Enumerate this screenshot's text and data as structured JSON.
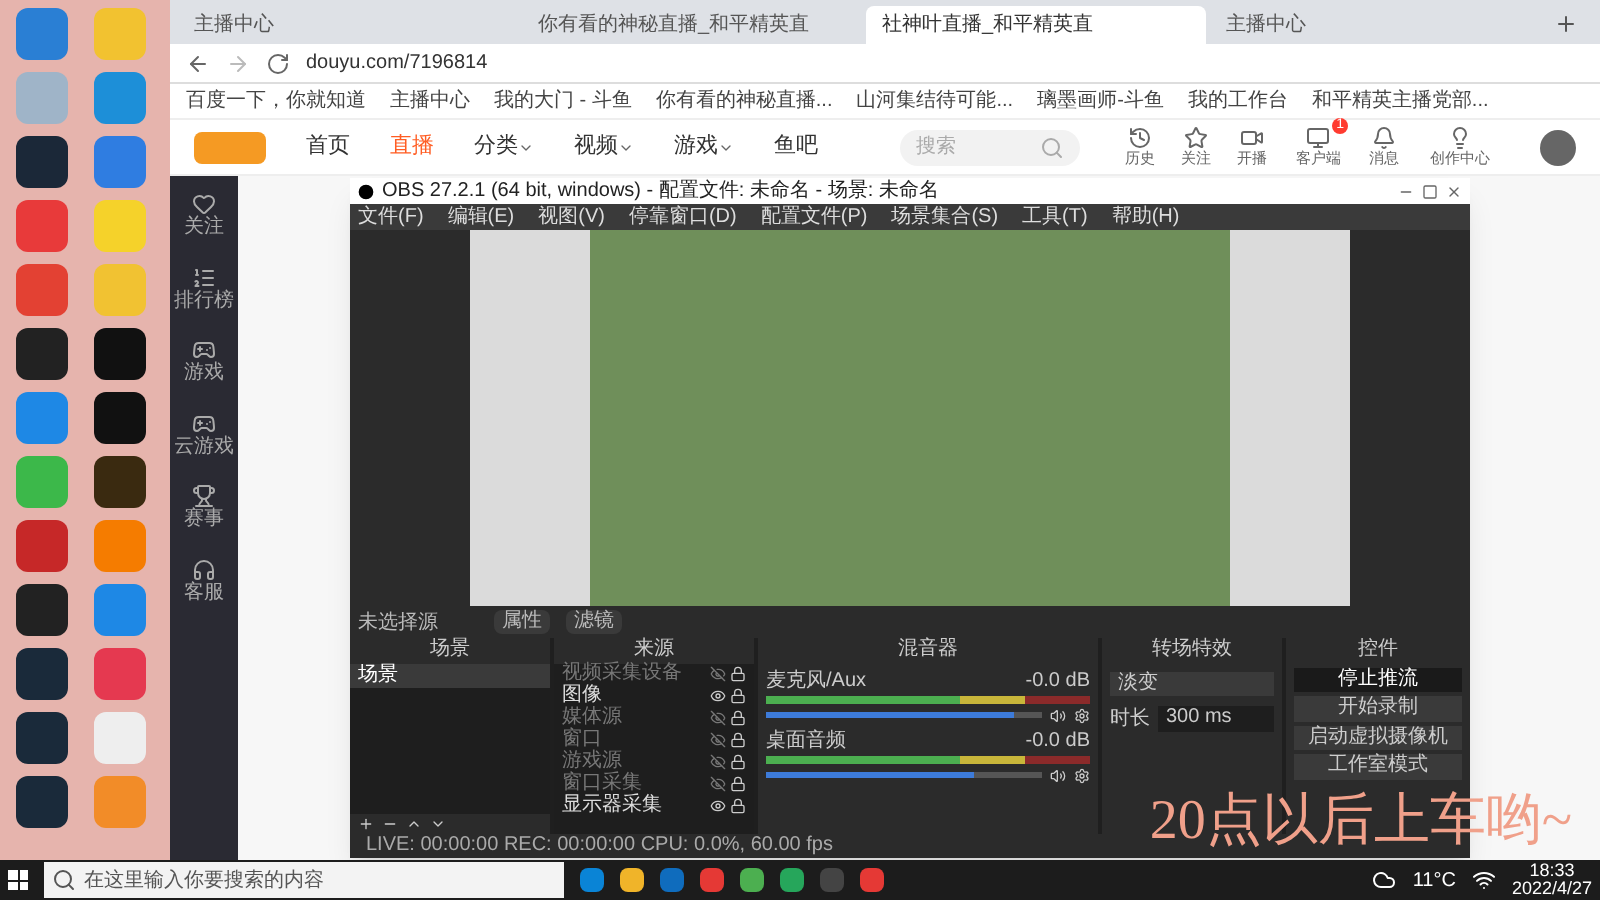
{
  "desktop": {
    "icons": [
      {
        "color": "#2a7fd4"
      },
      {
        "color": "#f2c230"
      },
      {
        "color": "#9fb4c8"
      },
      {
        "color": "#1d8fd8"
      },
      {
        "color": "#1b2838"
      },
      {
        "color": "#2f7de1"
      },
      {
        "color": "#e83a3a"
      },
      {
        "color": "#f5d22a"
      },
      {
        "color": "#e34133"
      },
      {
        "color": "#f1c232"
      },
      {
        "color": "#222222"
      },
      {
        "color": "#111111"
      },
      {
        "color": "#1e88e5"
      },
      {
        "color": "#111111"
      },
      {
        "color": "#3cb84a"
      },
      {
        "color": "#3a2a10"
      },
      {
        "color": "#c62828"
      },
      {
        "color": "#f57c00"
      },
      {
        "color": "#222222"
      },
      {
        "color": "#1e88e5"
      },
      {
        "color": "#1a2a3a"
      },
      {
        "color": "#e53950"
      },
      {
        "color": "#1a2a3a"
      },
      {
        "color": "#eeeeee"
      },
      {
        "color": "#1a2a3a"
      },
      {
        "color": "#f28c28"
      }
    ]
  },
  "browser": {
    "tabs": [
      {
        "label": "主播中心",
        "selected": false
      },
      {
        "label": "你有看的神秘直播_和平精英直",
        "selected": false
      },
      {
        "label": "社神叶直播_和平精英直",
        "selected": true
      },
      {
        "label": "主播中心",
        "selected": false
      }
    ],
    "address": "douyu.com/7196814",
    "bookmarks": [
      "百度一下，你就知道",
      "主播中心",
      "我的大门 - 斗鱼",
      "你有看的神秘直播...",
      "山河集结待可能...",
      "璃墨画师-斗鱼",
      "我的工作台",
      "和平精英主播党部..."
    ]
  },
  "site": {
    "nav": [
      {
        "label": "首页",
        "selected": false,
        "dropdown": false
      },
      {
        "label": "直播",
        "selected": true,
        "dropdown": false
      },
      {
        "label": "分类",
        "selected": false,
        "dropdown": true
      },
      {
        "label": "视频",
        "selected": false,
        "dropdown": true
      },
      {
        "label": "游戏",
        "selected": false,
        "dropdown": true
      },
      {
        "label": "鱼吧",
        "selected": false,
        "dropdown": false
      }
    ],
    "search_placeholder": "搜索",
    "header_icons": [
      "历史",
      "关注",
      "开播",
      "客户端",
      "消息",
      "创作中心"
    ],
    "notification_badge": "1",
    "sidebar": [
      "关注",
      "排行榜",
      "游戏",
      "云游戏",
      "赛事",
      "客服"
    ]
  },
  "obs": {
    "title": "OBS 27.2.1 (64 bit, windows) - 配置文件: 未命名 - 场景: 未命名",
    "menu": [
      "文件(F)",
      "编辑(E)",
      "视图(V)",
      "停靠窗口(D)",
      "配置文件(P)",
      "场景集合(S)",
      "工具(T)",
      "帮助(H)"
    ],
    "no_source": "未选择源",
    "source_buttons": [
      "属性",
      "滤镜"
    ],
    "docks": {
      "scenes": "场景",
      "sources": "来源",
      "mixer": "混音器",
      "transitions": "转场特效",
      "controls": "控件"
    },
    "scenes": [
      {
        "label": "场景",
        "selected": true
      }
    ],
    "sources": [
      {
        "label": "视频采集设备",
        "visible": false
      },
      {
        "label": "图像",
        "visible": true
      },
      {
        "label": "媒体源",
        "visible": false
      },
      {
        "label": "窗口",
        "visible": false
      },
      {
        "label": "游戏源",
        "visible": false
      },
      {
        "label": "窗口采集",
        "visible": false
      },
      {
        "label": "显示器采集",
        "visible": true
      }
    ],
    "channels": [
      {
        "name": "麦克风/Aux",
        "reading": "-0.0 dB",
        "level": 0.9
      },
      {
        "name": "桌面音频",
        "reading": "-0.0 dB",
        "level": 0.75
      }
    ],
    "transition": "淡变",
    "duration_label": "时长",
    "duration": "300 ms",
    "controls": [
      {
        "label": "停止推流",
        "active": true
      },
      {
        "label": "开始录制",
        "active": false
      },
      {
        "label": "启动虚拟摄像机",
        "active": false
      },
      {
        "label": "工作室模式",
        "active": false
      }
    ],
    "status": "LIVE: 00:00:00   REC: 00:00:00   CPU: 0.0%, 60.00 fps"
  },
  "overlay_text": "20点以后上车哟~",
  "taskbar": {
    "search_placeholder": "在这里输入你要搜索的内容",
    "weather": "11°C",
    "time": "18:33",
    "date": "2022/4/27"
  }
}
